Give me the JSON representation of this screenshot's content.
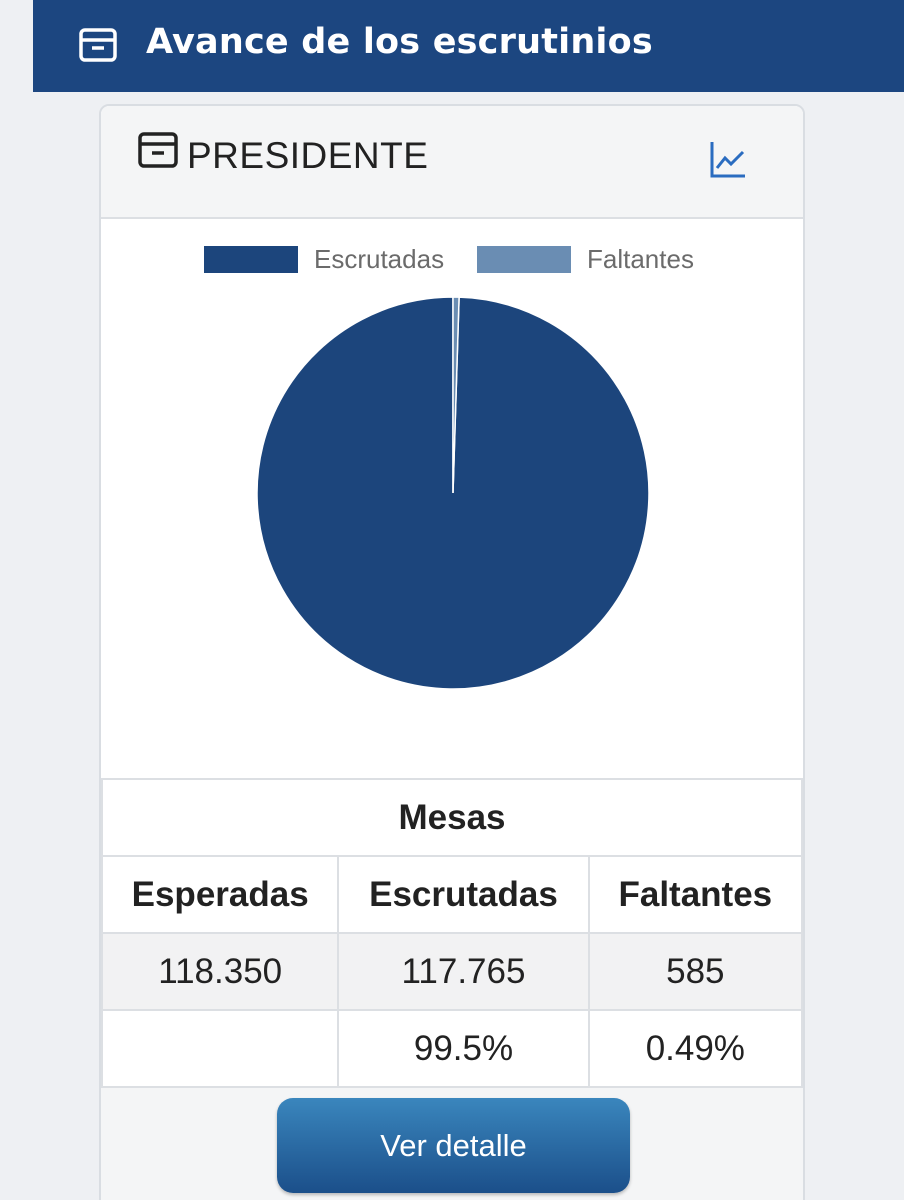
{
  "header": {
    "title": "Avance de los escrutinios",
    "icon": "archive-icon"
  },
  "card": {
    "title": "PRESIDENTE",
    "title_icon": "archive-icon",
    "chart_link_icon": "line-chart-icon"
  },
  "colors": {
    "header_bg": "#1c4680",
    "escrutadas": "#1c457c",
    "faltantes": "#6a8db3",
    "button": "#2a6aa3"
  },
  "chart_data": {
    "type": "pie",
    "categories": [
      "Escrutadas",
      "Faltantes"
    ],
    "values": [
      117765,
      585
    ],
    "legend": [
      "Escrutadas",
      "Faltantes"
    ],
    "legend_position": "top"
  },
  "table": {
    "caption": "Mesas",
    "headers": [
      "Esperadas",
      "Escrutadas",
      "Faltantes"
    ],
    "values": [
      "118.350",
      "117.765",
      "585"
    ],
    "percentages": [
      "",
      "99.5%",
      "0.49%"
    ]
  },
  "button": {
    "label": "Ver detalle"
  }
}
